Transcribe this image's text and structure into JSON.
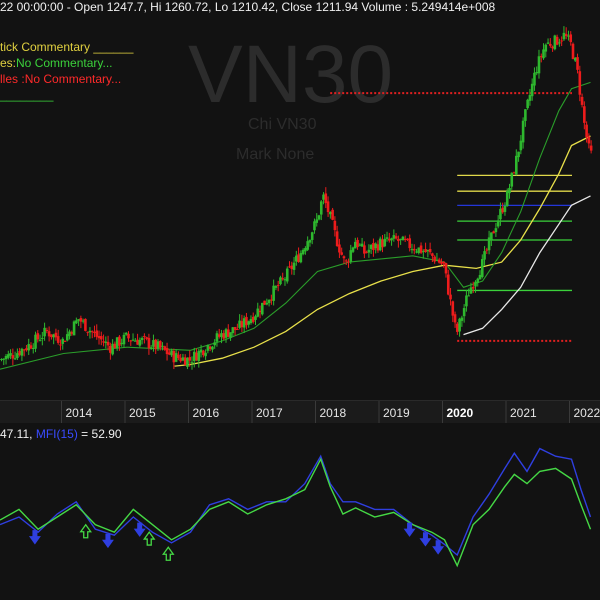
{
  "header": {
    "ohlc_line": "22 00:00:00 - Open 1247.7, Hi 1260.72, Lo 1210.42, Close 1211.94 Volume : 5.249414e+008",
    "candlestick_label": "tick Commentary ______",
    "moving_averages_label": "es:",
    "moving_averages_value": "No Commentary...",
    "fib_label": "lles :",
    "fib_value": "No Commentary...",
    "extra_rule": "________"
  },
  "watermark": {
    "symbol": "VN30",
    "chart_label": "Chi VN30",
    "market_label": "Mark None"
  },
  "indicator_header": {
    "rsi_text": "47.11,",
    "mfi_text": "MFI(15)",
    "mfi_value": "= 52.90"
  },
  "colors": {
    "up_candle": "#2eb82e",
    "down_candle": "#ee1c1c",
    "ma_fast": "#2a9d2a",
    "ma_slow": "#e8e04a",
    "fib_yellow": "#e0d84a",
    "fib_green": "#3bd13b",
    "fib_blue": "#2436d9",
    "fib_red": "#e02020",
    "white_ma": "#e8e8e8",
    "rsi": "#45d845",
    "mfi": "#2f3fe0",
    "header_text": "#f0f0f0",
    "commentary_text": "#e0d040",
    "no_commentary_green": "#3bd13b",
    "no_commentary_red": "#ff2a2a"
  },
  "chart_data": {
    "type": "candlestick",
    "x_ticks": [
      "2014",
      "2015",
      "2016",
      "2017",
      "2018",
      "2019",
      "2020",
      "2021",
      "2022"
    ],
    "highlighted_tick": "2020",
    "ylim": [
      480,
      1600
    ],
    "price_path": [
      [
        2013.0,
        560
      ],
      [
        2013.25,
        580
      ],
      [
        2013.5,
        610
      ],
      [
        2013.75,
        650
      ],
      [
        2014.0,
        620
      ],
      [
        2014.25,
        690
      ],
      [
        2014.5,
        640
      ],
      [
        2014.75,
        600
      ],
      [
        2015.0,
        630
      ],
      [
        2015.25,
        620
      ],
      [
        2015.5,
        600
      ],
      [
        2015.75,
        570
      ],
      [
        2016.0,
        560
      ],
      [
        2016.25,
        600
      ],
      [
        2016.5,
        640
      ],
      [
        2016.75,
        660
      ],
      [
        2017.0,
        700
      ],
      [
        2017.25,
        760
      ],
      [
        2017.5,
        820
      ],
      [
        2017.75,
        900
      ],
      [
        2018.0,
        1000
      ],
      [
        2018.1,
        1080
      ],
      [
        2018.2,
        1020
      ],
      [
        2018.3,
        950
      ],
      [
        2018.45,
        860
      ],
      [
        2018.6,
        940
      ],
      [
        2018.75,
        900
      ],
      [
        2019.0,
        930
      ],
      [
        2019.25,
        940
      ],
      [
        2019.5,
        920
      ],
      [
        2019.75,
        900
      ],
      [
        2020.0,
        860
      ],
      [
        2020.2,
        640
      ],
      [
        2020.4,
        780
      ],
      [
        2020.6,
        860
      ],
      [
        2020.8,
        980
      ],
      [
        2021.0,
        1080
      ],
      [
        2021.15,
        1200
      ],
      [
        2021.3,
        1350
      ],
      [
        2021.45,
        1480
      ],
      [
        2021.6,
        1560
      ],
      [
        2021.75,
        1570
      ],
      [
        2021.9,
        1590
      ],
      [
        2022.0,
        1560
      ],
      [
        2022.1,
        1480
      ],
      [
        2022.22,
        1300
      ],
      [
        2022.3,
        1212
      ]
    ],
    "ma_fast_path": [
      [
        2013.0,
        530
      ],
      [
        2014.0,
        580
      ],
      [
        2015.0,
        600
      ],
      [
        2016.0,
        590
      ],
      [
        2016.5,
        620
      ],
      [
        2017.0,
        660
      ],
      [
        2017.5,
        740
      ],
      [
        2018.0,
        840
      ],
      [
        2018.5,
        870
      ],
      [
        2019.0,
        880
      ],
      [
        2019.5,
        890
      ],
      [
        2020.0,
        870
      ],
      [
        2020.3,
        790
      ],
      [
        2020.6,
        810
      ],
      [
        2020.9,
        900
      ],
      [
        2021.2,
        1030
      ],
      [
        2021.5,
        1200
      ],
      [
        2021.8,
        1350
      ],
      [
        2022.0,
        1420
      ],
      [
        2022.3,
        1440
      ]
    ],
    "ma_slow_path": [
      [
        2015.75,
        540
      ],
      [
        2016.0,
        545
      ],
      [
        2016.5,
        565
      ],
      [
        2017.0,
        600
      ],
      [
        2017.5,
        650
      ],
      [
        2018.0,
        720
      ],
      [
        2018.5,
        770
      ],
      [
        2019.0,
        810
      ],
      [
        2019.5,
        840
      ],
      [
        2020.0,
        860
      ],
      [
        2020.5,
        850
      ],
      [
        2020.9,
        870
      ],
      [
        2021.2,
        940
      ],
      [
        2021.5,
        1040
      ],
      [
        2021.8,
        1150
      ],
      [
        2022.0,
        1240
      ],
      [
        2022.3,
        1270
      ]
    ],
    "white_ma_path": [
      [
        2020.3,
        640
      ],
      [
        2020.6,
        660
      ],
      [
        2020.9,
        720
      ],
      [
        2021.2,
        790
      ],
      [
        2021.5,
        900
      ],
      [
        2021.8,
        990
      ],
      [
        2022.0,
        1050
      ],
      [
        2022.3,
        1080
      ]
    ],
    "fib_levels": [
      {
        "value": 1406,
        "color": "red",
        "x_from": 2018.2
      },
      {
        "value": 1145,
        "color": "yellow",
        "x_from": 2020.2
      },
      {
        "value": 1095,
        "color": "yellow",
        "x_from": 2020.2
      },
      {
        "value": 1050,
        "color": "blue",
        "x_from": 2020.2
      },
      {
        "value": 1000,
        "color": "green",
        "x_from": 2020.2
      },
      {
        "value": 940,
        "color": "green",
        "x_from": 2020.2
      },
      {
        "value": 780,
        "color": "green",
        "x_from": 2020.2
      },
      {
        "value": 620,
        "color": "red",
        "x_from": 2020.2
      }
    ],
    "rsi_path": [
      [
        2013.0,
        48
      ],
      [
        2013.3,
        55
      ],
      [
        2013.6,
        42
      ],
      [
        2013.9,
        50
      ],
      [
        2014.2,
        58
      ],
      [
        2014.5,
        45
      ],
      [
        2014.8,
        40
      ],
      [
        2015.1,
        55
      ],
      [
        2015.4,
        45
      ],
      [
        2015.7,
        35
      ],
      [
        2016.0,
        42
      ],
      [
        2016.3,
        55
      ],
      [
        2016.6,
        60
      ],
      [
        2016.9,
        52
      ],
      [
        2017.2,
        58
      ],
      [
        2017.5,
        62
      ],
      [
        2017.8,
        68
      ],
      [
        2018.05,
        88
      ],
      [
        2018.2,
        70
      ],
      [
        2018.4,
        52
      ],
      [
        2018.6,
        56
      ],
      [
        2018.9,
        50
      ],
      [
        2019.2,
        53
      ],
      [
        2019.5,
        45
      ],
      [
        2019.8,
        40
      ],
      [
        2020.0,
        35
      ],
      [
        2020.2,
        18
      ],
      [
        2020.45,
        45
      ],
      [
        2020.7,
        55
      ],
      [
        2020.95,
        70
      ],
      [
        2021.1,
        78
      ],
      [
        2021.3,
        72
      ],
      [
        2021.5,
        80
      ],
      [
        2021.75,
        82
      ],
      [
        2022.0,
        75
      ],
      [
        2022.15,
        58
      ],
      [
        2022.3,
        42
      ]
    ],
    "mfi_path": [
      [
        2013.0,
        45
      ],
      [
        2013.3,
        50
      ],
      [
        2013.6,
        40
      ],
      [
        2013.9,
        52
      ],
      [
        2014.2,
        60
      ],
      [
        2014.5,
        42
      ],
      [
        2014.8,
        38
      ],
      [
        2015.1,
        50
      ],
      [
        2015.4,
        40
      ],
      [
        2015.7,
        33
      ],
      [
        2016.0,
        40
      ],
      [
        2016.3,
        58
      ],
      [
        2016.6,
        62
      ],
      [
        2016.9,
        55
      ],
      [
        2017.2,
        60
      ],
      [
        2017.5,
        60
      ],
      [
        2017.8,
        72
      ],
      [
        2018.05,
        90
      ],
      [
        2018.2,
        72
      ],
      [
        2018.4,
        60
      ],
      [
        2018.6,
        60
      ],
      [
        2018.9,
        55
      ],
      [
        2019.2,
        55
      ],
      [
        2019.5,
        45
      ],
      [
        2019.8,
        38
      ],
      [
        2020.0,
        32
      ],
      [
        2020.2,
        25
      ],
      [
        2020.45,
        50
      ],
      [
        2020.7,
        65
      ],
      [
        2020.95,
        82
      ],
      [
        2021.1,
        92
      ],
      [
        2021.3,
        80
      ],
      [
        2021.5,
        95
      ],
      [
        2021.75,
        90
      ],
      [
        2022.0,
        88
      ],
      [
        2022.15,
        68
      ],
      [
        2022.3,
        50
      ]
    ],
    "buy_arrows": [
      2014.35,
      2015.35,
      2015.65
    ],
    "sell_arrows": [
      2013.55,
      2014.7,
      2015.2,
      2019.45,
      2019.7,
      2019.9
    ]
  }
}
